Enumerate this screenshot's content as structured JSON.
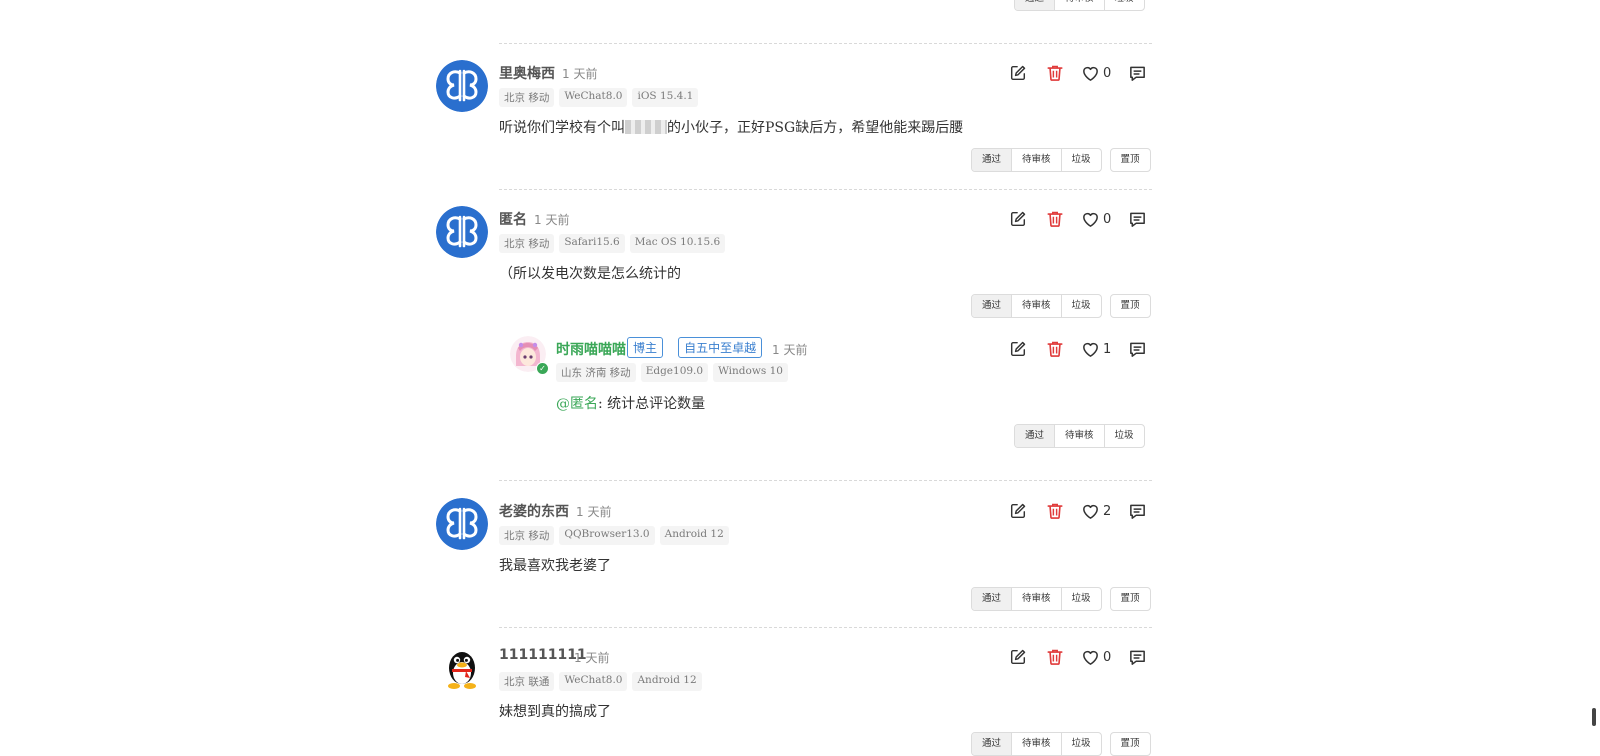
{
  "actions_colors": {
    "icon": "#333333",
    "delete": "#e03a3a",
    "reply_name": "#3aa757",
    "tag_border": "#4a90d9"
  },
  "icons": {
    "edit": "edit-icon",
    "delete": "trash-icon",
    "like": "heart-icon",
    "reply": "comment-icon"
  },
  "moderation": {
    "approve": "通过",
    "pending": "待审核",
    "spam": "垃圾",
    "pin": "置顶"
  },
  "comments": [
    {
      "name": "里奥梅西",
      "time": "1 天前",
      "meta": [
        "北京 移动",
        "WeChat8.0",
        "iOS 15.4.1"
      ],
      "content_before": "听说你们学校有个叫",
      "content_after": "的小伙子，正好PSG缺后方，希望他能来踢后腰",
      "likes": "0",
      "avatar": "butterfly"
    },
    {
      "name": "匿名",
      "time": "1 天前",
      "meta": [
        "北京 移动",
        "Safari15.6",
        "Mac OS 10.15.6"
      ],
      "content": "（所以发电次数是怎么统计的",
      "likes": "0",
      "avatar": "butterfly",
      "reply": {
        "name": "时雨喵喵喵",
        "tags": [
          "博主",
          "自五中至卓越"
        ],
        "time": "1 天前",
        "meta": [
          "山东 济南 移动",
          "Edge109.0",
          "Windows 10"
        ],
        "mention": "@匿名",
        "content": ": 统计总评论数量",
        "likes": "1",
        "avatar": "anime-girl"
      }
    },
    {
      "name": "老婆的东西",
      "time": "1 天前",
      "meta": [
        "北京 移动",
        "QQBrowser13.0",
        "Android 12"
      ],
      "content": "我最喜欢我老婆了",
      "likes": "2",
      "avatar": "butterfly"
    },
    {
      "name": "111111111",
      "time": "1 天前",
      "meta": [
        "北京 联通",
        "WeChat8.0",
        "Android 12"
      ],
      "content": "妹想到真的搞成了",
      "likes": "0",
      "avatar": "qq-penguin"
    }
  ]
}
